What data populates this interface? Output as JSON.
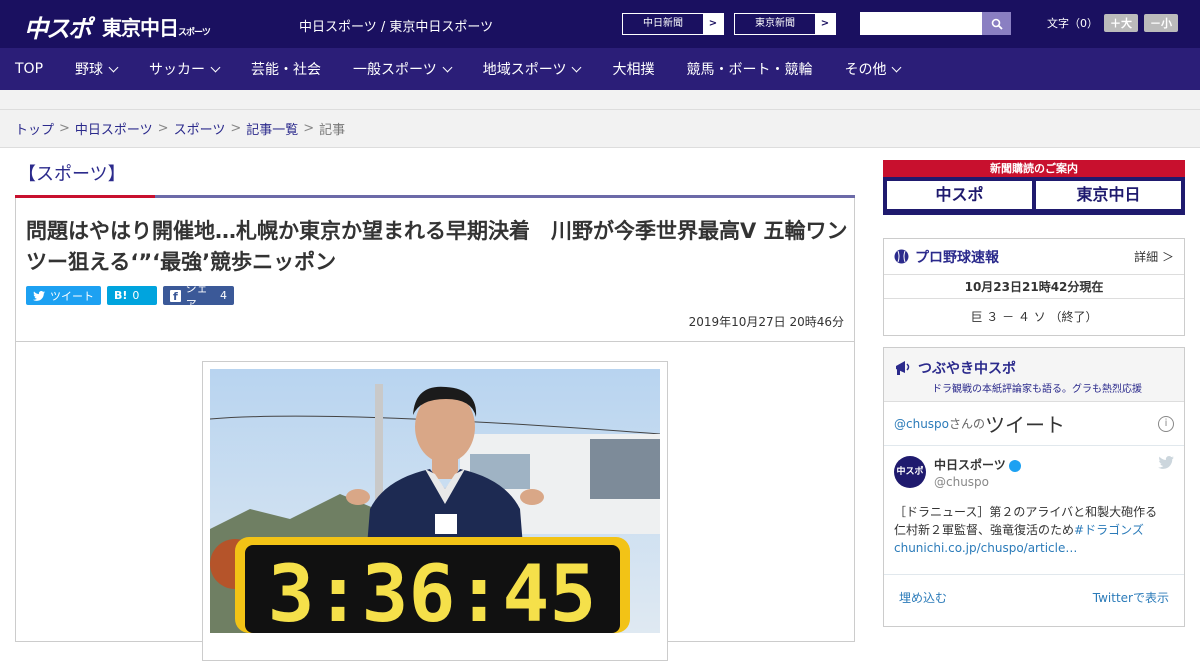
{
  "header": {
    "logo_a": "中スポ",
    "logo_b": "東京中日",
    "logo_b_small": "スポーツ",
    "site_name": "中日スポーツ / 東京中日スポーツ",
    "paper1": "中日新聞",
    "paper2": "東京新聞",
    "arrow": ">",
    "font_label": "文字（0）",
    "font_large": "＋大",
    "font_small": "－小"
  },
  "nav": [
    "TOP",
    "野球",
    "サッカー",
    "芸能・社会",
    "一般スポーツ",
    "地域スポーツ",
    "大相撲",
    "競馬・ボート・競輪",
    "その他"
  ],
  "breadcrumb": [
    "トップ",
    "中日スポーツ",
    "スポーツ",
    "記事一覧",
    "記事"
  ],
  "article": {
    "category": "【スポーツ】",
    "headline": "問題はやはり開催地…札幌か東京か望まれる早期決着　川野が今季世界最高V 五輪ワンツー狙える‘”‘最強’競歩ニッポン",
    "share_tweet": "ツイート",
    "share_hatena_icon": "B!",
    "share_hatena_count": "0",
    "share_fb": "シェア",
    "share_fb_count": "4",
    "date": "2019年10月27日 20時46分",
    "photo_timer": "3:36:45"
  },
  "sidebar": {
    "subscribe_title": "新聞購読のご案内",
    "subscribe_btn1": "中スポ",
    "subscribe_btn2": "東京中日",
    "baseball_title": "プロ野球速報",
    "baseball_more": "詳細 ＞",
    "baseball_time": "10月23日21時42分現在",
    "baseball_score": "巨 ３ － ４ ソ （終了）",
    "tw_title": "つぶやき中スポ",
    "tw_sub": "ドラ観戦の本紙評論家も語る。グラも熱烈応援",
    "tw_handle": "@chuspo",
    "tw_handle_suffix": "さんの",
    "tw_heading": "ツイート",
    "tweet_name": "中日スポーツ",
    "tweet_user": "@chuspo",
    "tweet_text": "［ドラニュース］第２のアライバと和製大砲作る　仁村新２軍監督、強竜復活のため",
    "tweet_link": "#ドラゴンズchunichi.co.jp/chuspo/article…",
    "embed": "埋め込む",
    "view_on_twitter": "Twitterで表示"
  }
}
